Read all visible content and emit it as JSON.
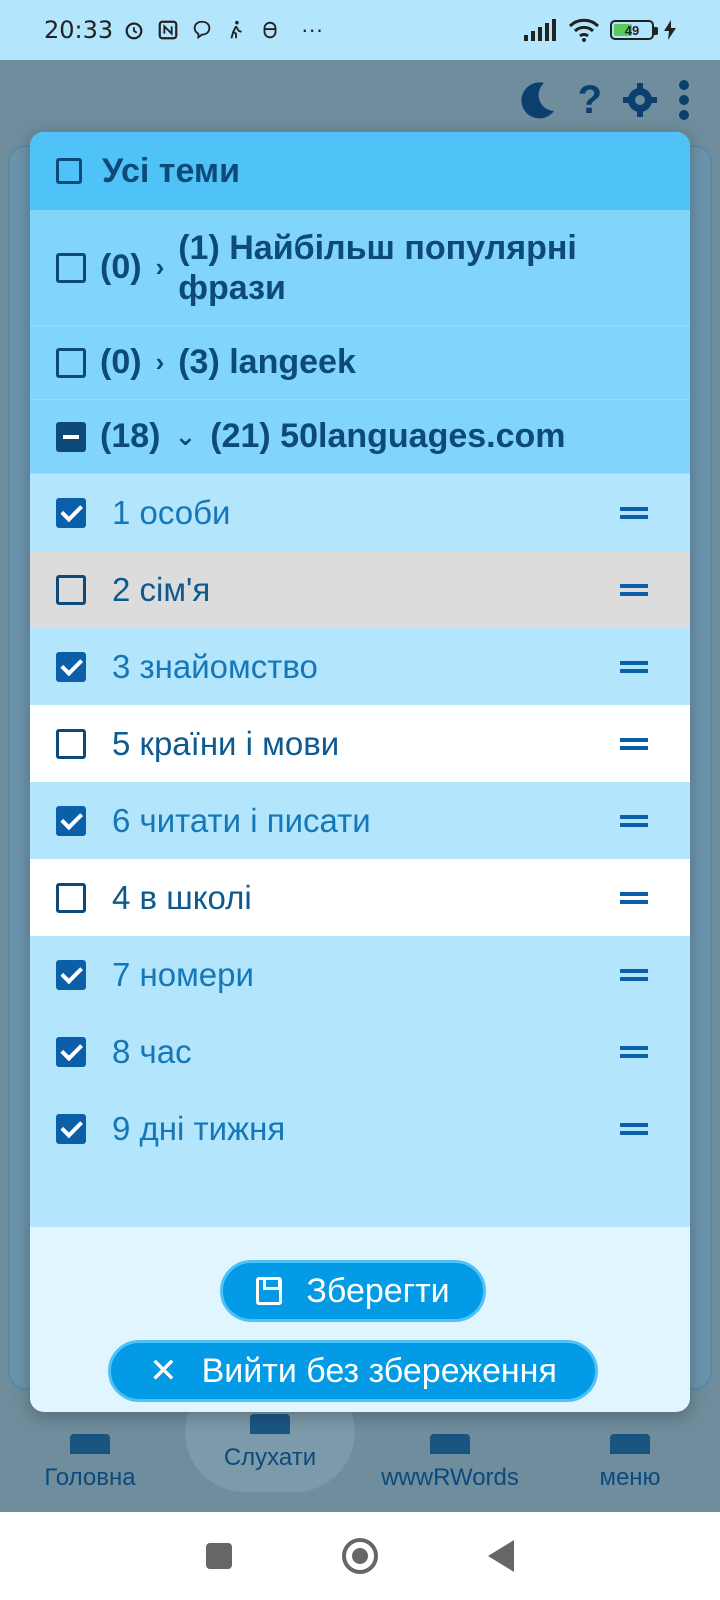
{
  "status_bar": {
    "time": "20:33",
    "battery": "49",
    "icons": [
      "alarm-icon",
      "nfc-icon",
      "viber-icon",
      "walk-icon",
      "mask-icon",
      "more-dots-icon"
    ],
    "more": "···"
  },
  "toolbar": {
    "icons": [
      "moon-icon",
      "help-icon",
      "gear-icon",
      "overflow-menu-icon"
    ],
    "help": "?"
  },
  "dialog": {
    "all_topics_label": "Усі теми",
    "groups": [
      {
        "count": "(0)",
        "title": "(1) Найбільш популярні фрази",
        "expanded": false
      },
      {
        "count": "(0)",
        "title": "(3) langeek",
        "expanded": false
      },
      {
        "count": "(18)",
        "title": "(21) 50languages.com",
        "expanded": true
      }
    ],
    "items": [
      {
        "label": "1 особи",
        "checked": true
      },
      {
        "label": "2 сім'я",
        "checked": false
      },
      {
        "label": "3 знайомство",
        "checked": true
      },
      {
        "label": "5 країни і мови",
        "checked": false
      },
      {
        "label": "6 читати і писати",
        "checked": true
      },
      {
        "label": "4 в школі",
        "checked": false
      },
      {
        "label": "7 номери",
        "checked": true
      },
      {
        "label": "8 час",
        "checked": true
      },
      {
        "label": "9 дні тижня",
        "checked": true
      }
    ],
    "save_label": "Зберегти",
    "exit_label": "Вийти без збереження"
  },
  "bottom_nav": {
    "items": [
      "Головна",
      "Слухати",
      "wwwRWords",
      "меню"
    ],
    "active": "Слухати"
  },
  "colors": {
    "header": "#4fc3f7",
    "group": "#81d4fa",
    "item_checked": "#b3e5fc",
    "button": "#039be5"
  }
}
